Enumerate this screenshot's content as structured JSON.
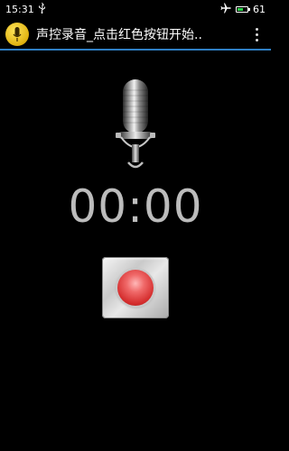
{
  "status_bar": {
    "time": "15:31",
    "usb_icon": "usb-icon",
    "airplane_icon": "airplane-icon",
    "battery_percent": "61",
    "battery_color": "#2bd14a"
  },
  "action_bar": {
    "title": "声控录音_点击红色按钮开始..",
    "icon": "microphone-app-icon",
    "menu_icon": "overflow-menu-icon",
    "accent_color": "#2f7fc4"
  },
  "main": {
    "mic_icon": "microphone-icon",
    "timer": "00:00",
    "record_color": "#d42d2d"
  }
}
